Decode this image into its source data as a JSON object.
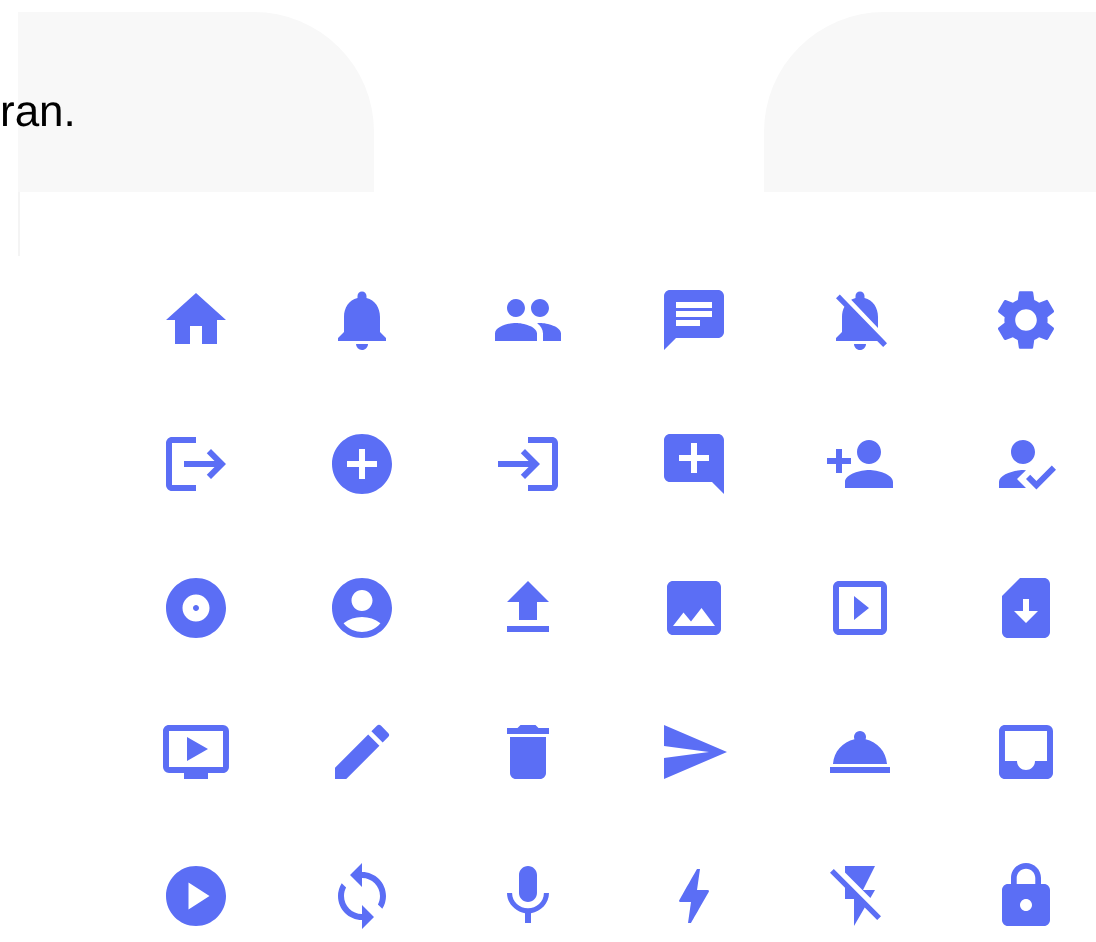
{
  "caption": "ran."
}
